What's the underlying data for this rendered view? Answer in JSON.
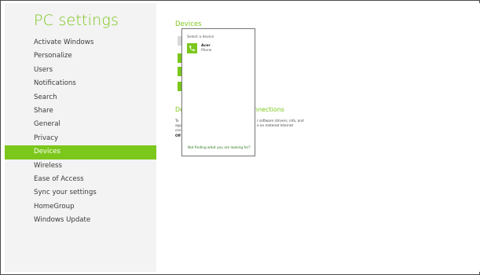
{
  "sidebar": {
    "title": "PC settings",
    "items": [
      {
        "label": "Activate Windows"
      },
      {
        "label": "Personalize"
      },
      {
        "label": "Users"
      },
      {
        "label": "Notifications"
      },
      {
        "label": "Search"
      },
      {
        "label": "Share"
      },
      {
        "label": "General"
      },
      {
        "label": "Privacy"
      },
      {
        "label": "Devices",
        "selected": true
      },
      {
        "label": "Wireless"
      },
      {
        "label": "Ease of Access"
      },
      {
        "label": "Sync your settings"
      },
      {
        "label": "HomeGroup"
      },
      {
        "label": "Windows Update"
      }
    ]
  },
  "main": {
    "title": "Devices",
    "section_heading_left": "De",
    "section_heading_right": "nnections",
    "fragments": {
      "line1_left": "To",
      "line1_right": "r software (drivers, info, and",
      "line2_left": "app",
      "line2_right": "e on metered Internet",
      "line3_left": "con",
      "status_left": "Off"
    }
  },
  "flyout": {
    "header": "Select a device",
    "device": {
      "name": "Acer",
      "type": "Phone",
      "icon": "phone-icon"
    },
    "footer_link": "Not finding what you are looking for?"
  },
  "colors": {
    "accent": "#7cc71b",
    "sidebar_bg": "#f3f3f3",
    "text": "#3b3b3b"
  }
}
